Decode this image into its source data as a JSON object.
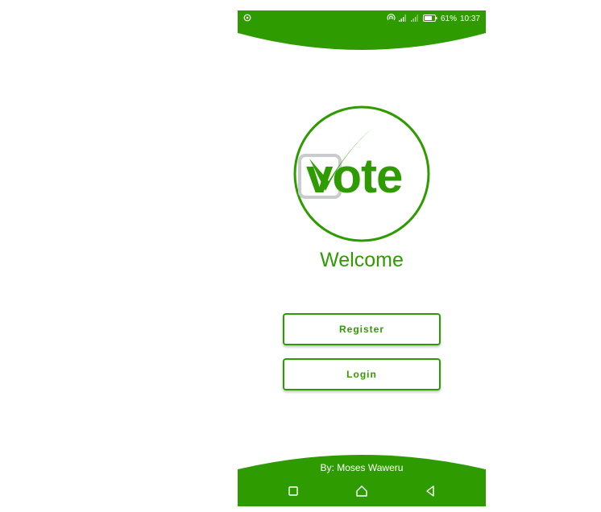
{
  "colors": {
    "accent": "#2e9c00",
    "white": "#ffffff",
    "logo_gray": "#c9cbcc"
  },
  "status_bar": {
    "left_icon": "sync-circle-icon",
    "icons": [
      "hotspot-icon",
      "signal-icon",
      "signal-icon",
      "battery-icon"
    ],
    "battery": "61%",
    "time": "10:37"
  },
  "logo": {
    "text": "vote",
    "icon": "checkmark-icon"
  },
  "welcome": {
    "title": "Welcome"
  },
  "buttons": {
    "register": "Register",
    "login": "Login"
  },
  "footer": {
    "credit": "By: Moses Waweru"
  },
  "navbar": {
    "icons": [
      "recent-apps-icon",
      "home-icon",
      "back-icon"
    ]
  }
}
